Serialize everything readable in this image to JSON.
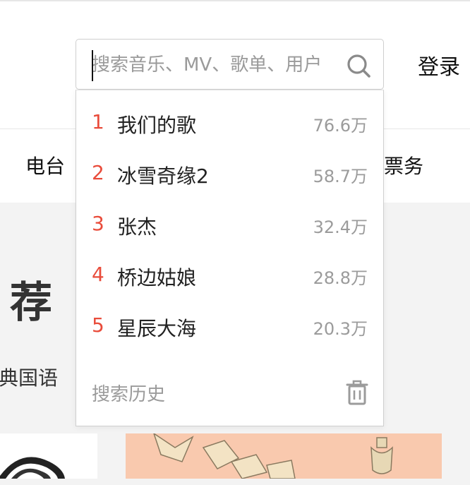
{
  "header": {
    "login_label": "登录"
  },
  "nav": {
    "radio_label": "电台",
    "tickets_label": "票务"
  },
  "content": {
    "heading": "荐",
    "subheading": "典国语"
  },
  "search": {
    "placeholder": "搜索音乐、MV、歌单、用户",
    "value": "",
    "icon": "search-icon"
  },
  "dropdown": {
    "hot_items": [
      {
        "rank": "1",
        "title": "我们的歌",
        "count": "76.6万"
      },
      {
        "rank": "2",
        "title": "冰雪奇缘2",
        "count": "58.7万"
      },
      {
        "rank": "3",
        "title": "张杰",
        "count": "32.4万"
      },
      {
        "rank": "4",
        "title": "桥边姑娘",
        "count": "28.8万"
      },
      {
        "rank": "5",
        "title": "星辰大海",
        "count": "20.3万"
      }
    ],
    "history_label": "搜索历史",
    "clear_icon": "trash-icon"
  },
  "colors": {
    "rank": "#e94c3b",
    "muted": "#9b9b9b",
    "band": "#f3f3f3"
  }
}
